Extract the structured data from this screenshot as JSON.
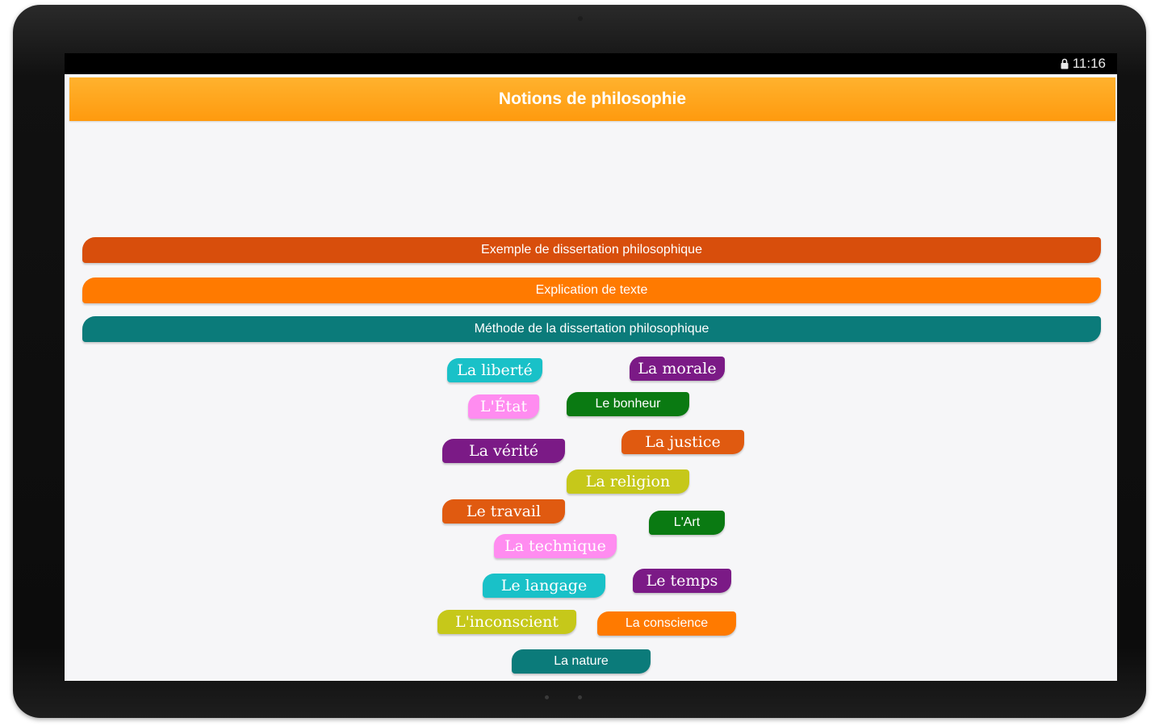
{
  "status_bar": {
    "time": "11:16",
    "icon": "lock-icon"
  },
  "app_bar": {
    "title": "Notions de philosophie"
  },
  "menu_buttons": [
    {
      "label": "Exemple de dissertation philosophique",
      "color": "#d84e0c"
    },
    {
      "label": "Explication de texte",
      "color": "#ff7a00"
    },
    {
      "label": "Méthode de la dissertation philosophique",
      "color": "#0b7b7a"
    }
  ],
  "notions": [
    {
      "label": "La liberté",
      "color": "#19c1c8"
    },
    {
      "label": "La morale",
      "color": "#7b1a86"
    },
    {
      "label": "L'État",
      "color": "#ff8cf0"
    },
    {
      "label": "Le bonheur",
      "color": "#0a7a12"
    },
    {
      "label": "La vérité",
      "color": "#7b1a86"
    },
    {
      "label": "La justice",
      "color": "#e05a10"
    },
    {
      "label": "La religion",
      "color": "#c6c81a"
    },
    {
      "label": "Le travail",
      "color": "#e05a10"
    },
    {
      "label": "L'Art",
      "color": "#0a7a12"
    },
    {
      "label": "La technique",
      "color": "#ff8cf0"
    },
    {
      "label": "Le langage",
      "color": "#19c1c8"
    },
    {
      "label": "Le temps",
      "color": "#7b1a86"
    },
    {
      "label": "L'inconscient",
      "color": "#c6c81a"
    },
    {
      "label": "La conscience",
      "color": "#ff7a00"
    },
    {
      "label": "La nature",
      "color": "#0b7b7a"
    }
  ]
}
